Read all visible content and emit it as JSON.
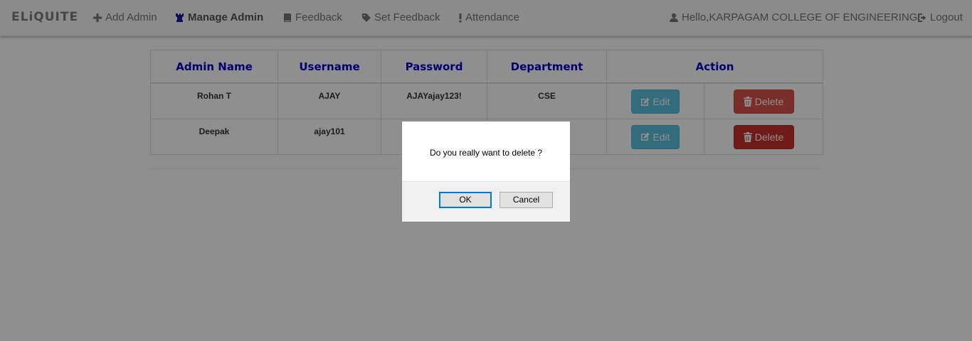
{
  "navbar": {
    "brand": "ELiQUITE",
    "items": [
      {
        "label": "Add Admin",
        "icon": "plus-icon"
      },
      {
        "label": "Manage Admin",
        "icon": "chess-rook-icon",
        "active": true
      },
      {
        "label": "Feedback",
        "icon": "book-icon"
      },
      {
        "label": "Set Feedback",
        "icon": "tag-icon"
      },
      {
        "label": "Attendance",
        "icon": "exclamation-icon"
      }
    ],
    "greeting": "Hello,KARPAGAM COLLEGE OF ENGINEERING",
    "user_icon": "user-icon",
    "logout": "Logout",
    "logout_icon": "logout-icon"
  },
  "table": {
    "headers": [
      "Admin Name",
      "Username",
      "Password",
      "Department",
      "Action"
    ],
    "rows": [
      {
        "name": "Rohan T",
        "username": "AJAY",
        "password": "AJAYajay123!",
        "department": "CSE",
        "edit": "Edit",
        "delete": "Delete"
      },
      {
        "name": "Deepak",
        "username": "ajay101",
        "password": "",
        "department": "",
        "edit": "Edit",
        "delete": "Delete"
      }
    ]
  },
  "dialog": {
    "message": "Do you really want to delete ?",
    "ok": "OK",
    "cancel": "Cancel"
  },
  "colors": {
    "header_text": "#0000cc",
    "edit_button": "#5bc0de",
    "delete_button": "#d9534f",
    "overlay": "rgba(0,0,0,0.44)"
  }
}
